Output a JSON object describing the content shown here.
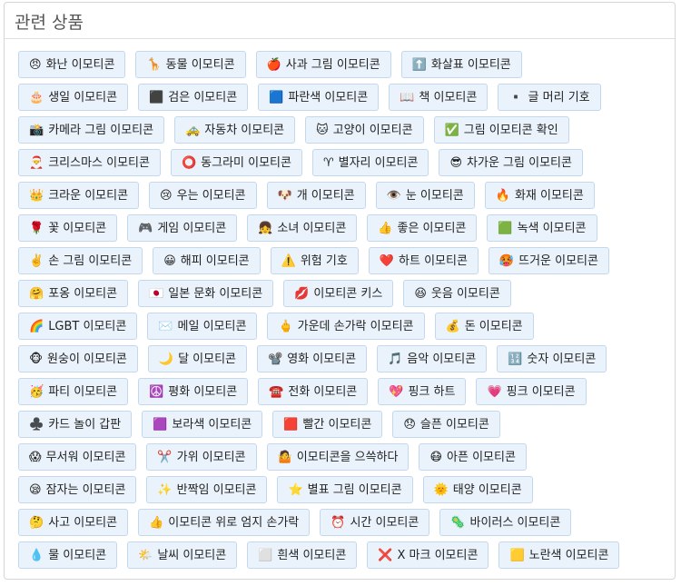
{
  "panel": {
    "title": "관련 상품"
  },
  "rows": [
    [
      {
        "icon": "😠",
        "label": "화난 이모티콘"
      },
      {
        "icon": "🦒",
        "label": "동물 이모티콘"
      },
      {
        "icon": "🍎",
        "label": "사과 그림 이모티콘"
      },
      {
        "icon": "⬆️",
        "label": "화살표 이모티콘"
      }
    ],
    [
      {
        "icon": "🎂",
        "label": "생일 이모티콘"
      },
      {
        "icon": "⬛",
        "label": "검은 이모티콘"
      },
      {
        "icon": "🟦",
        "label": "파란색 이모티콘"
      },
      {
        "icon": "📖",
        "label": "책 이모티콘"
      },
      {
        "icon": "▪️",
        "label": "글 머리 기호"
      }
    ],
    [
      {
        "icon": "📸",
        "label": "카메라 그림 이모티콘"
      },
      {
        "icon": "🚕",
        "label": "자동차 이모티콘"
      },
      {
        "icon": "🐱",
        "label": "고양이 이모티콘"
      },
      {
        "icon": "✅",
        "label": "그림 이모티콘 확인"
      }
    ],
    [
      {
        "icon": "🎅",
        "label": "크리스마스 이모티콘"
      },
      {
        "icon": "⭕",
        "label": "동그라미 이모티콘"
      },
      {
        "icon": "♈",
        "label": "별자리 이모티콘"
      },
      {
        "icon": "😎",
        "label": "차가운 그림 이모티콘"
      }
    ],
    [
      {
        "icon": "👑",
        "label": "크라운 이모티콘"
      },
      {
        "icon": "😢",
        "label": "우는 이모티콘"
      },
      {
        "icon": "🐶",
        "label": "개 이모티콘"
      },
      {
        "icon": "👁️",
        "label": "눈 이모티콘"
      },
      {
        "icon": "🔥",
        "label": "화재 이모티콘"
      }
    ],
    [
      {
        "icon": "🌹",
        "label": "꽃 이모티콘"
      },
      {
        "icon": "🎮",
        "label": "게임 이모티콘"
      },
      {
        "icon": "👧",
        "label": "소녀 이모티콘"
      },
      {
        "icon": "👍",
        "label": "좋은 이모티콘"
      },
      {
        "icon": "🟩",
        "label": "녹색 이모티콘"
      }
    ],
    [
      {
        "icon": "✌️",
        "label": "손 그림 이모티콘"
      },
      {
        "icon": "😀",
        "label": "해피 이모티콘"
      },
      {
        "icon": "⚠️",
        "label": "위험 기호"
      },
      {
        "icon": "❤️",
        "label": "하트 이모티콘"
      },
      {
        "icon": "🥵",
        "label": "뜨거운 이모티콘"
      }
    ],
    [
      {
        "icon": "🤗",
        "label": "포옹 이모티콘"
      },
      {
        "icon": "🇯🇵",
        "label": "일본 문화 이모티콘"
      },
      {
        "icon": "💋",
        "label": "이모티콘 키스"
      },
      {
        "icon": "😆",
        "label": "웃음 이모티콘"
      }
    ],
    [
      {
        "icon": "🌈",
        "label": "LGBT 이모티콘"
      },
      {
        "icon": "✉️",
        "label": "메일 이모티콘"
      },
      {
        "icon": "🖕",
        "label": "가운데 손가락 이모티콘"
      },
      {
        "icon": "💰",
        "label": "돈 이모티콘"
      }
    ],
    [
      {
        "icon": "🐵",
        "label": "원숭이 이모티콘"
      },
      {
        "icon": "🌙",
        "label": "달 이모티콘"
      },
      {
        "icon": "📽️",
        "label": "영화 이모티콘"
      },
      {
        "icon": "🎵",
        "label": "음악 이모티콘"
      },
      {
        "icon": "🔢",
        "label": "숫자 이모티콘"
      }
    ],
    [
      {
        "icon": "🥳",
        "label": "파티 이모티콘"
      },
      {
        "icon": "☮️",
        "label": "평화 이모티콘"
      },
      {
        "icon": "☎️",
        "label": "전화 이모티콘"
      },
      {
        "icon": "💖",
        "label": "핑크 하트"
      },
      {
        "icon": "💗",
        "label": "핑크 이모티콘"
      }
    ],
    [
      {
        "icon": "♣️",
        "label": "카드 놀이 갑판"
      },
      {
        "icon": "🟪",
        "label": "보라색 이모티콘"
      },
      {
        "icon": "🟥",
        "label": "빨간 이모티콘"
      },
      {
        "icon": "😞",
        "label": "슬픈 이모티콘"
      }
    ],
    [
      {
        "icon": "😱",
        "label": "무서워 이모티콘"
      },
      {
        "icon": "✂️",
        "label": "가위 이모티콘"
      },
      {
        "icon": "🤷",
        "label": "이모티콘을 으쓱하다"
      },
      {
        "icon": "😷",
        "label": "아픈 이모티콘"
      }
    ],
    [
      {
        "icon": "😪",
        "label": "잠자는 이모티콘"
      },
      {
        "icon": "✨",
        "label": "반짝임 이모티콘"
      },
      {
        "icon": "⭐",
        "label": "별표 그림 이모티콘"
      },
      {
        "icon": "🌞",
        "label": "태양 이모티콘"
      }
    ],
    [
      {
        "icon": "🤔",
        "label": "사고 이모티콘"
      },
      {
        "icon": "👍",
        "label": "이모티콘 위로 엄지 손가락"
      },
      {
        "icon": "⏰",
        "label": "시간 이모티콘"
      },
      {
        "icon": "🦠",
        "label": "바이러스 이모티콘"
      }
    ],
    [
      {
        "icon": "💧",
        "label": "물 이모티콘"
      },
      {
        "icon": "🌤️",
        "label": "날씨 이모티콘"
      },
      {
        "icon": "⬜",
        "label": "흰색 이모티콘"
      },
      {
        "icon": "❌",
        "label": "X 마크 이모티콘"
      },
      {
        "icon": "🟨",
        "label": "노란색 이모티콘"
      }
    ]
  ]
}
